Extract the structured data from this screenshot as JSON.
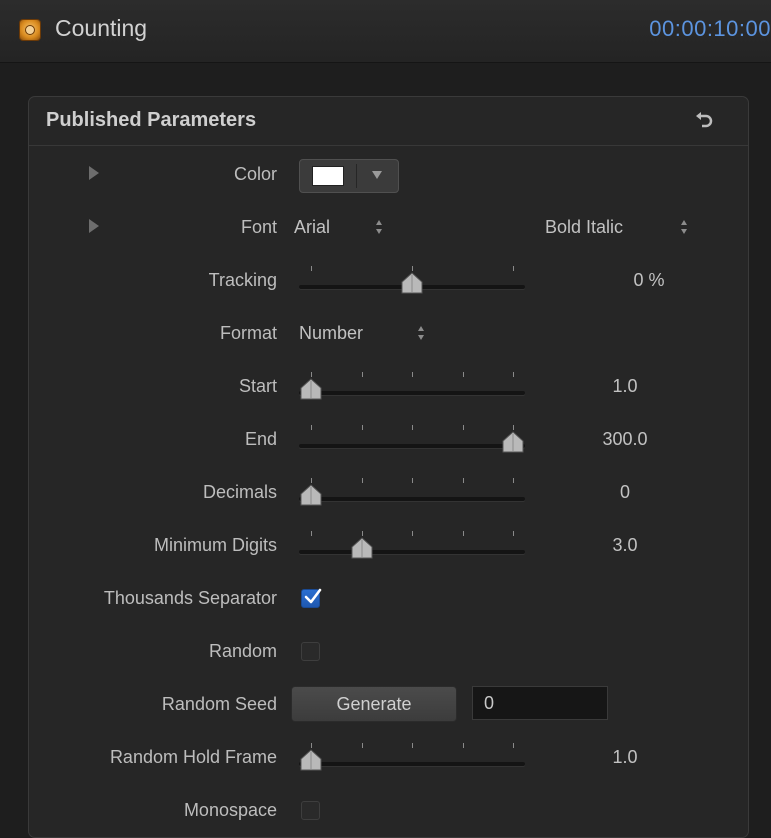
{
  "window": {
    "title": "Counting",
    "timecode": "00:00:10:00",
    "app_icon": "motion-project-icon"
  },
  "panel": {
    "title": "Published Parameters",
    "reset_icon": "reset-arrow-icon"
  },
  "color_param": {
    "label": "Color",
    "value": "#ffffff"
  },
  "font_param": {
    "label": "Font",
    "family": "Arial",
    "style": "Bold Italic"
  },
  "tracking": {
    "label": "Tracking",
    "value_text": "0 %",
    "fraction": 0.5
  },
  "format": {
    "label": "Format",
    "value": "Number"
  },
  "start": {
    "label": "Start",
    "value_text": "1.0",
    "fraction": 0.0
  },
  "end": {
    "label": "End",
    "value_text": "300.0",
    "fraction": 1.0
  },
  "decimals": {
    "label": "Decimals",
    "value_text": "0",
    "fraction": 0.0
  },
  "min_digits": {
    "label": "Minimum Digits",
    "value_text": "3.0",
    "fraction": 0.25
  },
  "thousands_sep": {
    "label": "Thousands Separator",
    "checked": true
  },
  "random": {
    "label": "Random",
    "checked": false
  },
  "random_seed": {
    "label": "Random Seed",
    "button_label": "Generate",
    "value": "0"
  },
  "random_hold": {
    "label": "Random Hold Frame",
    "value_text": "1.0",
    "fraction": 0.0
  },
  "monospace": {
    "label": "Monospace",
    "checked": false
  }
}
